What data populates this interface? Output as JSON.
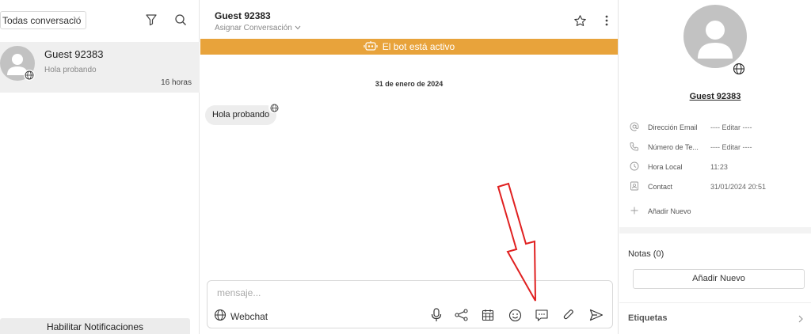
{
  "sidebar": {
    "filter_label": "Todas conversacio",
    "conversation": {
      "name": "Guest 92383",
      "preview": "Hola probando",
      "time": "16 horas"
    },
    "notifications_button": "Habilitar Notificaciones"
  },
  "chat": {
    "title": "Guest 92383",
    "assign_label": "Asignar Conversación",
    "bot_banner": "El bot está activo",
    "date_separator": "31 de enero de 2024",
    "messages": [
      {
        "text": "Hola probando"
      }
    ],
    "composer": {
      "placeholder": "mensaje...",
      "channel": "Webchat"
    }
  },
  "profile": {
    "name": "Guest 92383",
    "fields": [
      {
        "label": "Dirección Email",
        "value": "---- Editar ----",
        "icon": "at-icon"
      },
      {
        "label": "Número de Te...",
        "value": "---- Editar ----",
        "icon": "phone-icon"
      },
      {
        "label": "Hora Local",
        "value": "11:23",
        "icon": "clock-icon"
      },
      {
        "label": "Contact",
        "value": "31/01/2024 20:51",
        "icon": "contact-card-icon"
      }
    ],
    "add_field_label": "Añadir Nuevo",
    "notes_title": "Notas (0)",
    "add_note_label": "Añadir Nuevo",
    "tags_title": "Etiquetas"
  },
  "colors": {
    "bot_banner": "#e8a33b",
    "selected_row": "#efefef",
    "avatar": "#c2c2c2",
    "annotation_arrow": "#e02020"
  }
}
